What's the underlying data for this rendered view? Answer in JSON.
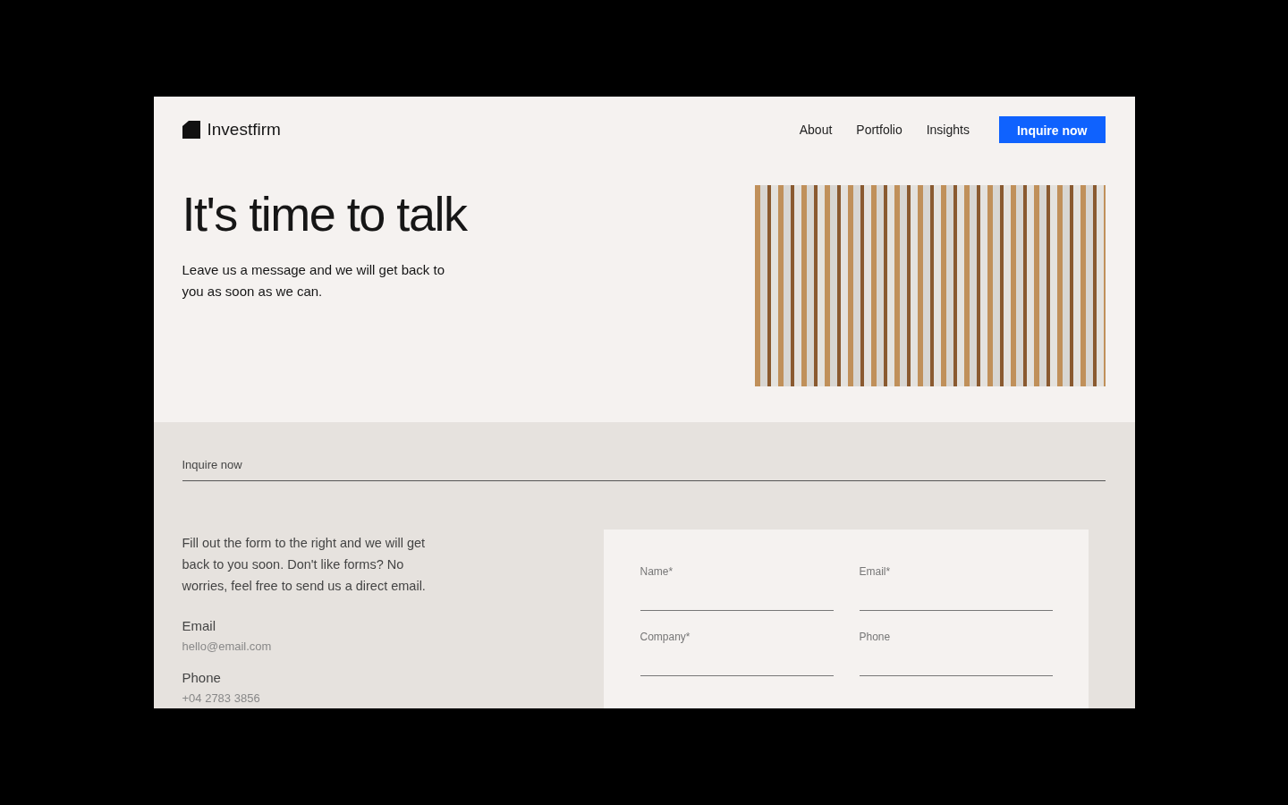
{
  "brand": {
    "name": "Investfirm"
  },
  "nav": {
    "links": [
      "About",
      "Portfolio",
      "Insights"
    ],
    "cta": "Inquire now"
  },
  "hero": {
    "title": "It's time to talk",
    "subtitle": "Leave us a message and we will get back to you as soon as we can."
  },
  "inquiry": {
    "heading": "Inquire now",
    "intro": "Fill out the form to the right and we will get back to you soon. Don't like forms? No worries, feel free to send us a direct email.",
    "contacts": [
      {
        "label": "Email",
        "value": "hello@email.com"
      },
      {
        "label": "Phone",
        "value": "+04 2783 3856"
      }
    ],
    "form": {
      "fields": [
        {
          "label": "Name*"
        },
        {
          "label": "Email*"
        },
        {
          "label": "Company*"
        },
        {
          "label": "Phone"
        }
      ]
    }
  }
}
